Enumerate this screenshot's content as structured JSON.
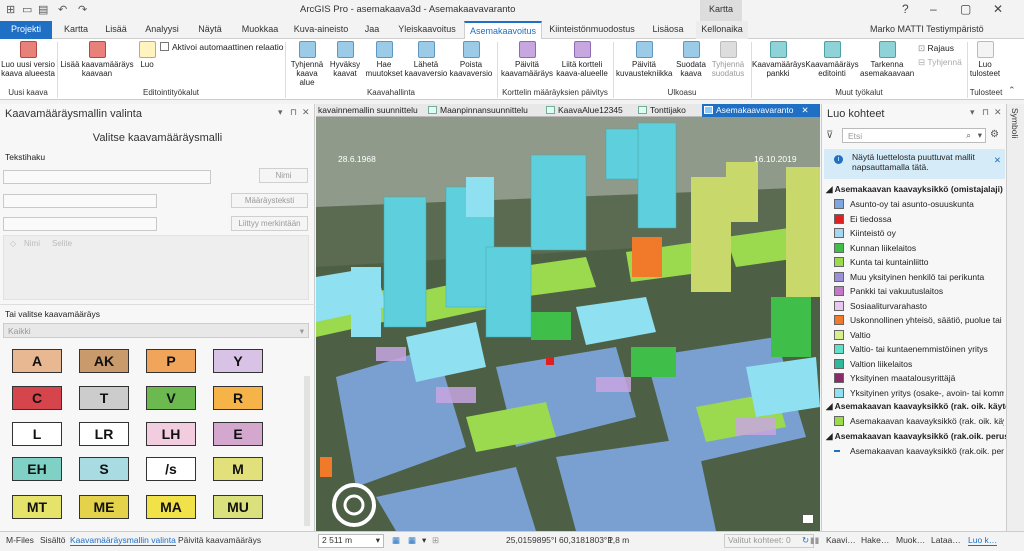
{
  "app": {
    "title": "ArcGIS Pro - asemakaava3d - Asemakaavavaranto",
    "context_group": "Kartta",
    "user": "Marko MATTI Testiympäristö",
    "help": "?"
  },
  "tabs": [
    "Projekti",
    "Kartta",
    "Lisää",
    "Analyysi",
    "Näytä",
    "Muokkaa",
    "Kuva-aineisto",
    "Jaa",
    "Yleiskaavoitus",
    "Asemakaavoitus",
    "Kiinteistönmuodostus",
    "Lisäosa",
    "Kellonaika"
  ],
  "ribbon": {
    "buttons": [
      {
        "label": "Luo uusi versio kaava alueesta",
        "icon": "new-version-icon",
        "color": "pink"
      },
      {
        "label": "Lisää kaavamääräys kaavaan",
        "icon": "add-regulation-icon",
        "color": "pink"
      },
      {
        "label": "Luo",
        "icon": "create-icon",
        "color": "pencil"
      },
      {
        "label": "Tyhjennä kaava alue",
        "icon": "clear-area-icon",
        "color": "blue"
      },
      {
        "label": "Hyväksy kaavat",
        "icon": "approve-icon",
        "color": "blue"
      },
      {
        "label": "Hae muutokset",
        "icon": "fetch-changes-icon",
        "color": "blue"
      },
      {
        "label": "Lähetä kaavaversio",
        "icon": "send-version-icon",
        "color": "blue"
      },
      {
        "label": "Poista kaavaversio",
        "icon": "delete-version-icon",
        "color": "blue"
      },
      {
        "label": "Päivitä kaavamääräys",
        "icon": "update-regulation-icon",
        "color": "purp"
      },
      {
        "label": "Liitä kortteli kaava-alueelle",
        "icon": "attach-block-icon",
        "color": "purp"
      },
      {
        "label": "Päivitä kuvaustekniikka",
        "icon": "update-technique-icon",
        "color": "blue"
      },
      {
        "label": "Suodata kaava",
        "icon": "filter-plan-icon",
        "color": "blue"
      },
      {
        "label": "Tyhjennä suodatus",
        "icon": "clear-filter-icon",
        "color": "grey"
      },
      {
        "label": "Kaavamääräys pankki",
        "icon": "regulation-bank-icon",
        "color": "teal"
      },
      {
        "label": "Kaavamääräys editointi",
        "icon": "regulation-edit-icon",
        "color": "teal"
      },
      {
        "label": "Tarkenna asemakaavaan",
        "icon": "refine-plan-icon",
        "color": "teal"
      },
      {
        "label": "Luo tulosteet",
        "icon": "print-icon",
        "color": "grey"
      }
    ],
    "checkbox_label": "Aktivoi automaattinen relaatio",
    "rajaus": "Rajaus",
    "tyhjenna": "Tyhjennä",
    "groups": [
      "Uusi kaava",
      "Editointityökalut",
      "Kaavahallinta",
      "Korttelin määräyksien päivitys",
      "Ulkoasu",
      "Muut työkalut",
      "Tulosteet"
    ]
  },
  "left_panel": {
    "title": "Kaavamääräysmallin valinta",
    "subtitle": "Valitse kaavamääräysmalli",
    "search_label": "Tekstihaku",
    "btn_name": "Nimi",
    "btn_text": "Määräysteksti",
    "btn_related": "Liittyy merkintään",
    "col_name": "Nimi",
    "col_selite": "Selite",
    "pick_label": "Tai valitse kaavamääräys",
    "dropdown_value": "Kaikki",
    "tiles": [
      {
        "code": "A",
        "bg": "#e7b892"
      },
      {
        "code": "AK",
        "bg": "#c99a6c"
      },
      {
        "code": "P",
        "bg": "#f0a55a"
      },
      {
        "code": "Y",
        "bg": "#d8c3e6"
      },
      {
        "code": "C",
        "bg": "#d5454b"
      },
      {
        "code": "T",
        "bg": "#cccccc"
      },
      {
        "code": "V",
        "bg": "#6bb94f"
      },
      {
        "code": "R",
        "bg": "#f6b348"
      },
      {
        "code": "L",
        "bg": "#ffffff"
      },
      {
        "code": "LR",
        "bg": "#ffffff"
      },
      {
        "code": "LH",
        "bg": "#f2cde0"
      },
      {
        "code": "E",
        "bg": "#d4a7cf"
      },
      {
        "code": "EH",
        "bg": "#7fd1c6"
      },
      {
        "code": "S",
        "bg": "#a9dbe2"
      },
      {
        "code": "/s",
        "bg": "#ffffff"
      },
      {
        "code": "M",
        "bg": "#e2e07a"
      },
      {
        "code": "MT",
        "bg": "#e6e36a"
      },
      {
        "code": "ME",
        "bg": "#e4d34a"
      },
      {
        "code": "MA",
        "bg": "#f2e24a"
      },
      {
        "code": "MU",
        "bg": "#d9e07c"
      }
    ]
  },
  "map": {
    "view_tabs": [
      "kavainnemallin suunnittelu",
      "Maanpinnansuunnittelu",
      "KaavaAlue12345",
      "Tonttijako",
      "Asemakaavavaranto"
    ],
    "date_left": "28.6.1968",
    "date_right": "16.10.2019",
    "scale": "2 511 m",
    "coords": "25,0159895°I 60,3181803°P",
    "elevation": "1,8 m",
    "selected": "Valitut kohteet: 0"
  },
  "right_panel": {
    "title": "Luo kohteet",
    "search_placeholder": "Etsi",
    "info": "Näytä luettelosta puuttuvat mallit napsauttamalla tätä.",
    "group1": "Asemakaavan kaavayksikkö (omistajalaji)",
    "items": [
      {
        "label": "Asunto-oy tai asunto-osuuskunta",
        "color": "#7ea7e0"
      },
      {
        "label": "Ei tiedossa",
        "color": "#e02020"
      },
      {
        "label": "Kiinteistö oy",
        "color": "#a7d7f0"
      },
      {
        "label": "Kunnan liikelaitos",
        "color": "#3fbf4a"
      },
      {
        "label": "Kunta tai kuntainliitto",
        "color": "#9bd94f"
      },
      {
        "label": "Muu yksityinen henkilö tai perikunta",
        "color": "#9b8fd8"
      },
      {
        "label": "Pankki tai vakuutuslaitos",
        "color": "#c07ac8"
      },
      {
        "label": "Sosiaaliturvarahasto",
        "color": "#e8c8f0"
      },
      {
        "label": "Uskonnollinen yhteisö, säätiö, puolue tai y…",
        "color": "#f07a2a"
      },
      {
        "label": "Valtio",
        "color": "#d8ee8a"
      },
      {
        "label": "Valtio- tai kuntaenemmistöinen yritys",
        "color": "#5fe0c8"
      },
      {
        "label": "Valtion liikelaitos",
        "color": "#2fb89a"
      },
      {
        "label": "Yksityinen maatalousyrittäjä",
        "color": "#8a2a6a"
      },
      {
        "label": "Yksityinen yritys (osake-, avoin- tai komm…",
        "color": "#8fe0f0"
      }
    ],
    "group2": "Asemakaavan kaavayksikkö (rak. oik. käytett…",
    "group2_item": "Asemakaavan kaavayksikkö (rak. oik. käyte…",
    "group3": "Asemakaavan kaavayksikkö (rak.oik. perusm…",
    "group3_item": "Asemakaavan kaavayksikkö (rak.oik. perus…",
    "vertical": "Symboli"
  },
  "bottom": {
    "left_tabs": [
      "M-Files",
      "Sisältö",
      "Kaavamääräysmallin valinta",
      "Päivitä kaavamääräys"
    ],
    "right_tabs": [
      "Kaavi…",
      "Hake…",
      "Muok…",
      "Lataa…",
      "Luo k…"
    ]
  }
}
